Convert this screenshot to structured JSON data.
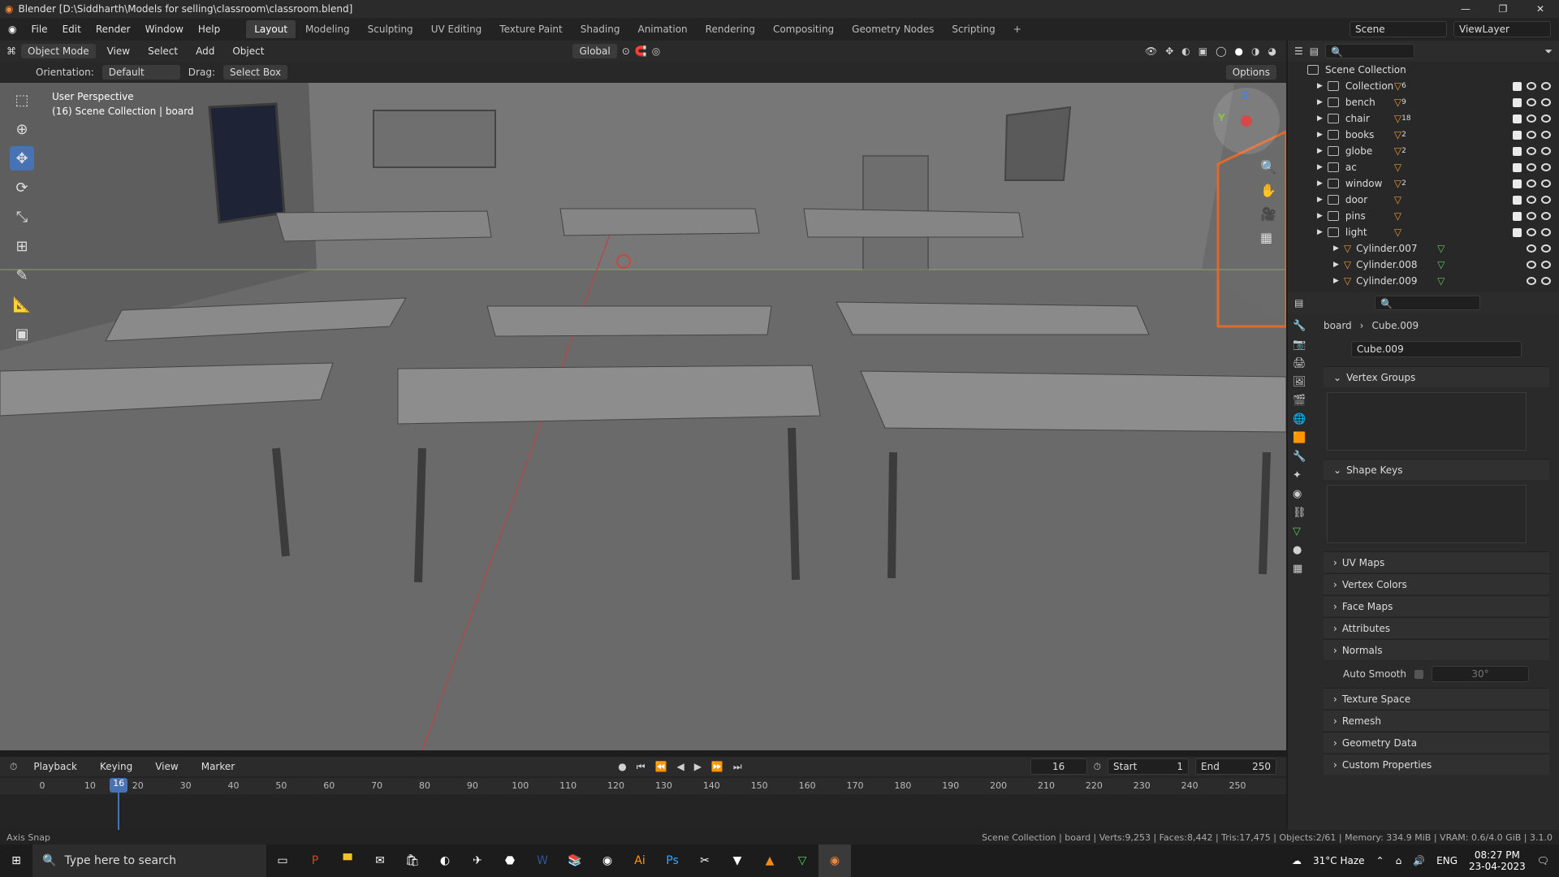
{
  "window": {
    "title": "Blender [D:\\Siddharth\\Models for selling\\classroom\\classroom.blend]",
    "controls": [
      "—",
      "❐",
      "✕"
    ]
  },
  "menus": [
    "File",
    "Edit",
    "Render",
    "Window",
    "Help"
  ],
  "workspaces": [
    "Layout",
    "Modeling",
    "Sculpting",
    "UV Editing",
    "Texture Paint",
    "Shading",
    "Animation",
    "Rendering",
    "Compositing",
    "Geometry Nodes",
    "Scripting"
  ],
  "active_workspace": "Layout",
  "scene": {
    "label": "Scene",
    "viewlayer": "ViewLayer"
  },
  "viewport_header": {
    "mode": "Object Mode",
    "menus": [
      "View",
      "Select",
      "Add",
      "Object"
    ],
    "transform": "Global"
  },
  "tool_header": {
    "orientation_label": "Orientation:",
    "orientation_value": "Default",
    "drag_label": "Drag:",
    "drag_value": "Select Box",
    "options": "Options"
  },
  "viewport": {
    "perspective": "User Perspective",
    "collection_info": "(16) Scene Collection | board"
  },
  "outliner": {
    "root": "Scene Collection",
    "items": [
      {
        "name": "Collection",
        "badge": "6"
      },
      {
        "name": "bench",
        "badge": "9"
      },
      {
        "name": "chair",
        "badge": "18"
      },
      {
        "name": "books",
        "badge": "2"
      },
      {
        "name": "globe",
        "badge": "2"
      },
      {
        "name": "ac",
        "badge": ""
      },
      {
        "name": "window",
        "badge": "2"
      },
      {
        "name": "door",
        "badge": ""
      },
      {
        "name": "pins",
        "badge": ""
      },
      {
        "name": "light",
        "badge": ""
      }
    ],
    "children": [
      "Cylinder.007",
      "Cylinder.008",
      "Cylinder.009"
    ]
  },
  "properties": {
    "breadcrumb": [
      "board",
      "Cube.009"
    ],
    "data_name": "Cube.009",
    "panels_open": [
      "Vertex Groups",
      "Shape Keys"
    ],
    "panels": [
      "UV Maps",
      "Vertex Colors",
      "Face Maps",
      "Attributes",
      "Normals",
      "Texture Space",
      "Remesh",
      "Geometry Data",
      "Custom Properties"
    ],
    "auto_smooth_label": "Auto Smooth",
    "auto_smooth_angle": "30°"
  },
  "timeline": {
    "menus": [
      "Playback",
      "Keying",
      "View",
      "Marker"
    ],
    "current_frame": "16",
    "start_label": "Start",
    "start": "1",
    "end_label": "End",
    "end": "250",
    "ticks": [
      "0",
      "10",
      "20",
      "30",
      "40",
      "50",
      "60",
      "70",
      "80",
      "90",
      "100",
      "110",
      "120",
      "130",
      "140",
      "150",
      "160",
      "170",
      "180",
      "190",
      "200",
      "210",
      "220",
      "230",
      "240",
      "250"
    ],
    "playhead": "16"
  },
  "status": {
    "left": "Axis Snap",
    "right": "Scene Collection | board | Verts:9,253 | Faces:8,442 | Tris:17,475 | Objects:2/61 | Memory: 334.9 MiB | VRAM: 0.6/4.0 GiB | 3.1.0"
  },
  "taskbar": {
    "search_placeholder": "Type here to search",
    "weather": "31°C Haze",
    "lang": "ENG",
    "time": "08:27 PM",
    "date": "23-04-2023"
  },
  "colors": {
    "accent": "#4772b3",
    "viewport_bg": "#6b6b6b",
    "playhead": "#4772b3"
  }
}
